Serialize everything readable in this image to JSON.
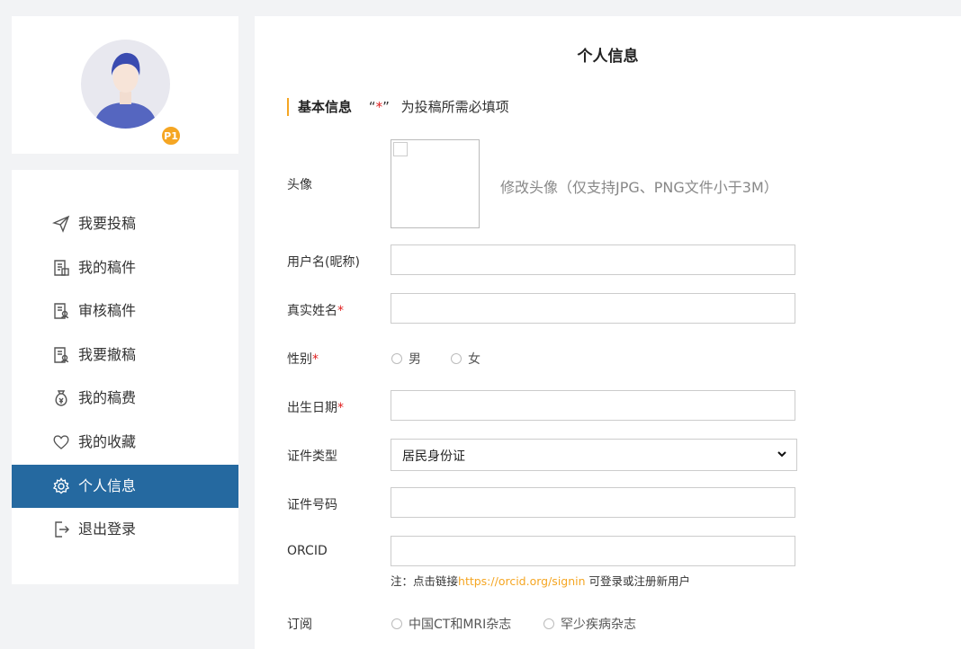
{
  "profile": {
    "level_badge": "P1"
  },
  "menu": {
    "items": [
      {
        "label": "我要投稿",
        "icon": "send-icon"
      },
      {
        "label": "我的稿件",
        "icon": "document-list-icon"
      },
      {
        "label": "审核稿件",
        "icon": "document-review-icon"
      },
      {
        "label": "我要撤稿",
        "icon": "document-withdraw-icon"
      },
      {
        "label": "我的稿费",
        "icon": "money-bag-icon"
      },
      {
        "label": "我的收藏",
        "icon": "heart-icon"
      },
      {
        "label": "个人信息",
        "icon": "gear-icon",
        "active": true
      },
      {
        "label": "退出登录",
        "icon": "logout-icon"
      }
    ]
  },
  "main": {
    "title": "个人信息",
    "section": {
      "title": "基本信息",
      "quote_open": "“",
      "star": "*",
      "quote_close": "”",
      "note": "为投稿所需必填项"
    },
    "fields": {
      "avatar_label": "头像",
      "avatar_hint": "修改头像（仅支持JPG、PNG文件小于3M）",
      "username_label": "用户名(昵称)",
      "username_value": "",
      "realname_label": "真实姓名",
      "realname_value": "",
      "gender_label": "性别",
      "gender_options": [
        "男",
        "女"
      ],
      "birthdate_label": "出生日期",
      "birthdate_value": "",
      "idtype_label": "证件类型",
      "idtype_value": "居民身份证",
      "idnumber_label": "证件号码",
      "idnumber_value": "",
      "orcid_label": "ORCID",
      "orcid_value": "",
      "orcid_note_prefix": "注：点击链接",
      "orcid_link": "https://orcid.org/signin",
      "orcid_note_suffix": " 可登录或注册新用户",
      "subscribe_label": "订阅",
      "subscribe_options": [
        "中国CT和MRI杂志",
        "罕少疾病杂志"
      ],
      "required_mark": "*"
    }
  },
  "colors": {
    "accent": "#f5a623",
    "active_menu": "#2569a0",
    "required": "#e02020"
  }
}
